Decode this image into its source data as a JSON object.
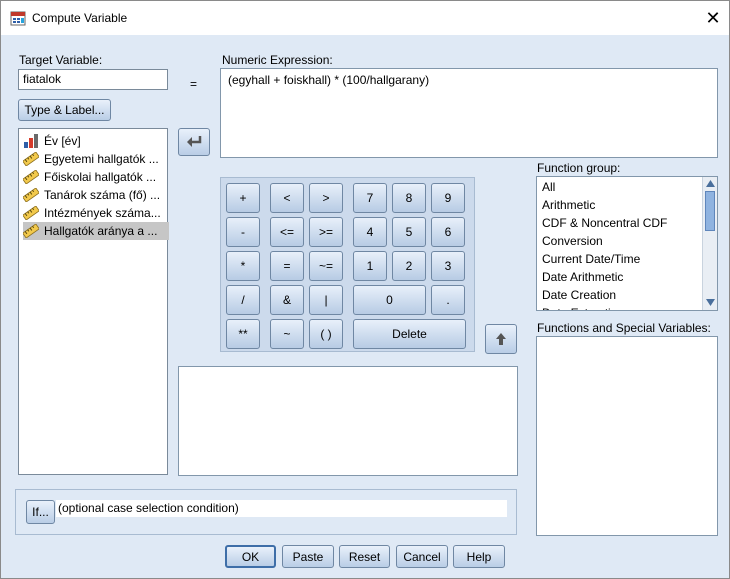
{
  "window": {
    "title": "Compute Variable",
    "close_glyph": "✕"
  },
  "target": {
    "label": "Target Variable:",
    "value": "fiatalok",
    "type_label_button": "Type & Label..."
  },
  "equals": "=",
  "expression": {
    "label": "Numeric Expression:",
    "value": "(egyhall + foiskhall) * (100/hallgarany)"
  },
  "variables": [
    {
      "label": "Év [év]",
      "icon": "ordinal-icon"
    },
    {
      "label": "Egyetemi hallgatók ...",
      "icon": "scale-icon"
    },
    {
      "label": "Főiskolai hallgatók ...",
      "icon": "scale-icon"
    },
    {
      "label": "Tanárok száma (fő) ...",
      "icon": "scale-icon"
    },
    {
      "label": "Intézmények száma...",
      "icon": "scale-icon"
    },
    {
      "label": "Hallgatók aránya a ...",
      "icon": "scale-icon",
      "selected": true
    }
  ],
  "keypad": {
    "plus": "+",
    "lt": "<",
    "gt": ">",
    "seven": "7",
    "eight": "8",
    "nine": "9",
    "minus": "-",
    "le": "<=",
    "ge": ">=",
    "four": "4",
    "five": "5",
    "six": "6",
    "mult": "*",
    "eq": "=",
    "ne": "~=",
    "one": "1",
    "two": "2",
    "three": "3",
    "div": "/",
    "and": "&",
    "or": "|",
    "zero": "0",
    "dot": ".",
    "pow": "**",
    "not": "~",
    "paren": "( )",
    "delete": "Delete"
  },
  "function_group": {
    "label": "Function group:",
    "items": [
      "All",
      "Arithmetic",
      "CDF & Noncentral CDF",
      "Conversion",
      "Current Date/Time",
      "Date Arithmetic",
      "Date Creation",
      "Date Extraction"
    ]
  },
  "functions_label": "Functions and Special Variables:",
  "condition": {
    "if_button": "If...",
    "text": "(optional case selection condition)"
  },
  "footer": {
    "ok": "OK",
    "paste": "Paste",
    "reset": "Reset",
    "cancel": "Cancel",
    "help": "Help"
  },
  "colors": {
    "dialog_bg": "#dfe9f5",
    "button_gradient_top": "#e9f1fb",
    "button_gradient_bottom": "#b9cde6",
    "keypad_bg": "#ccdaec"
  }
}
